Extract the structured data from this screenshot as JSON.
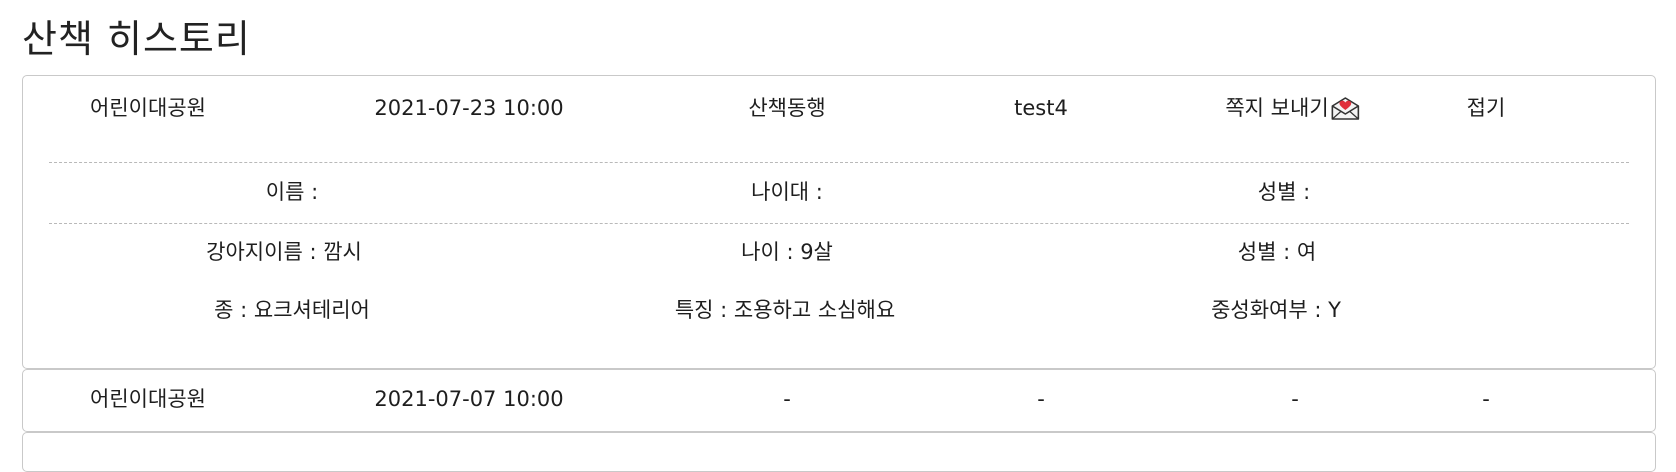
{
  "page": {
    "title": "산책 히스토리"
  },
  "history": [
    {
      "place": "어린이대공원",
      "datetime": "2021-07-23 10:00",
      "status": "산책동행",
      "user": "test4",
      "message_label": "쪽지 보내기",
      "toggle_label": "접기",
      "owner": {
        "name": "이름 :",
        "age_group": "나이대 :",
        "gender": "성별 :"
      },
      "dog": {
        "name": "강아지이름 : 깜시",
        "age": "나이 : 9살",
        "gender": "성별 : 여",
        "breed": "종 : 요크셔테리어",
        "feature": "특징 : 조용하고 소심해요",
        "neutered": "중성화여부 : Y"
      }
    },
    {
      "place": "어린이대공원",
      "datetime": "2021-07-07 10:00",
      "status": "-",
      "user": "-",
      "message_label": "-",
      "toggle_label": "-"
    }
  ],
  "icons": {
    "message": "envelope-heart-icon"
  },
  "colors": {
    "border": "#c9c9c9",
    "heart": "#e0303c",
    "text": "#1e1e1e"
  }
}
